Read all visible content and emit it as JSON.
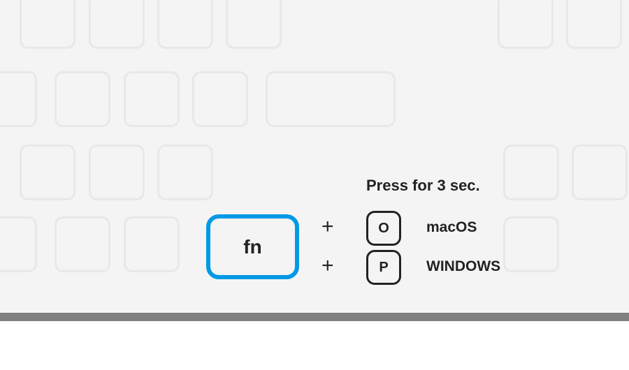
{
  "instruction": {
    "press_duration_label": "Press for 3 sec.",
    "modifier_key_label": "fn",
    "combos": [
      {
        "plus": "+",
        "key_label": "O",
        "os_label": "macOS"
      },
      {
        "plus": "+",
        "key_label": "P",
        "os_label": "WINDOWS"
      }
    ]
  },
  "colors": {
    "highlight": "#0099e5",
    "ghost_border": "#e8e8e8",
    "text": "#222222",
    "separator": "#808080"
  }
}
